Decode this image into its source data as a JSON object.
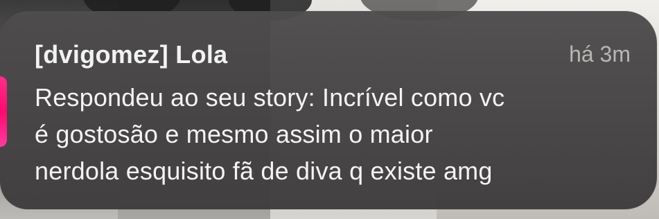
{
  "notification": {
    "sender": "[dvigomez] Lola",
    "time": "há 3m",
    "body_lines": [
      "Respondeu ao seu story: Incrível como vc",
      "é gostosão e mesmo assim o maior",
      "nerdola esquisito fã de diva q existe amg"
    ]
  },
  "app_icon": {
    "name": "instagram-icon",
    "color": "#ff0a6e"
  }
}
